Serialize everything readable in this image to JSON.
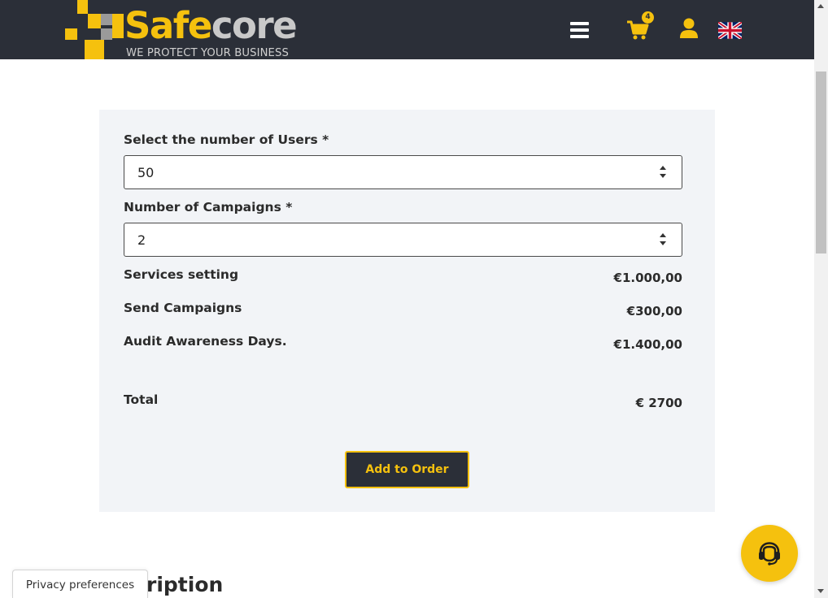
{
  "header": {
    "brand_part1": "Safe",
    "brand_part2": "core",
    "tagline": "WE PROTECT YOUR BUSINESS",
    "cart_count": "4",
    "language_flag": "uk-flag"
  },
  "form": {
    "users_label": "Select the number of Users *",
    "users_value": "50",
    "campaigns_label": "Number of Campaigns *",
    "campaigns_value": "2",
    "lines": [
      {
        "label": "Services setting",
        "value": "€1.000,00"
      },
      {
        "label": "Send Campaigns",
        "value": "€300,00"
      },
      {
        "label": "Audit Awareness Days.",
        "value": "€1.400,00"
      }
    ],
    "total_label": "Total",
    "total_value": "€ 2700",
    "add_button": "Add to Order"
  },
  "footer": {
    "section_heading_partial": "ription",
    "privacy_label": "Privacy preferences"
  },
  "icons": {
    "menu": "hamburger-menu-icon",
    "cart": "cart-icon",
    "user": "user-icon",
    "support": "headset-icon"
  },
  "colors": {
    "accent": "#f5c10e",
    "header_bg": "#2b2f38",
    "panel_bg": "#f2f4f7"
  }
}
